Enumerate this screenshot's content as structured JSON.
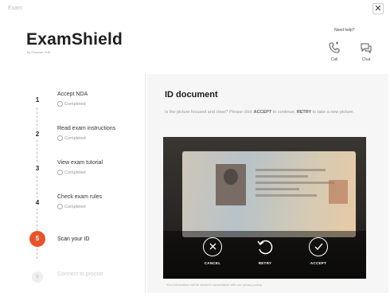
{
  "window": {
    "title": "Exam",
    "close_symbol": "✕"
  },
  "header": {
    "brand": "ExamShield",
    "brand_sub": "by Pearson VUE",
    "help_label": "Need help?",
    "call_label": "Call",
    "chat_label": "Chat"
  },
  "steps": [
    {
      "num": "1",
      "title": "Accept NDA",
      "status": "Completed",
      "state": "completed"
    },
    {
      "num": "2",
      "title": "Read exam instructions",
      "status": "Completed",
      "state": "completed"
    },
    {
      "num": "3",
      "title": "View exam tutorial",
      "status": "Completed",
      "state": "completed"
    },
    {
      "num": "4",
      "title": "Check exam rules",
      "status": "Completed",
      "state": "completed"
    },
    {
      "num": "5",
      "title": "Scan your ID",
      "status": "",
      "state": "active"
    },
    {
      "num": "6",
      "title": "Connect to proctor",
      "status": "",
      "state": "disabled"
    }
  ],
  "main": {
    "title": "ID document",
    "instruction_pre": "Is the picture focused and clear? Please click ",
    "instruction_accept": "ACCEPT",
    "instruction_mid": " to continue, ",
    "instruction_retry": "RETRY",
    "instruction_post": " to take a new picture.",
    "footnote": "Your information will be stored in accordance with our privacy policy."
  },
  "camera": {
    "cancel_label": "CANCEL",
    "retry_label": "RETRY",
    "accept_label": "ACCEPT"
  },
  "colors": {
    "accent": "#e8542a",
    "completed": "#999999"
  }
}
